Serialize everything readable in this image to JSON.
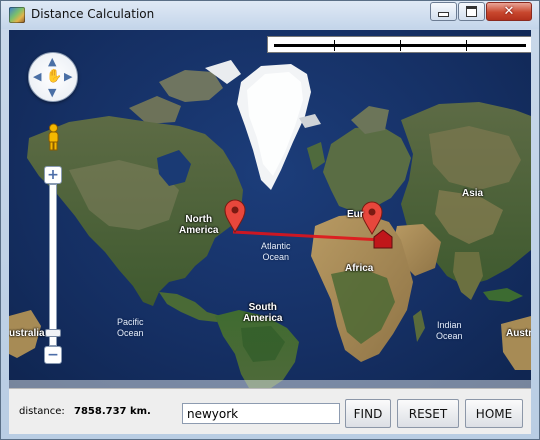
{
  "window": {
    "title": "Distance Calculation"
  },
  "map": {
    "labels": {
      "north_america": "North\nAmerica",
      "atlantic_ocean": "Atlantic\nOcean",
      "europe": "Eur",
      "asia": "Asia",
      "africa": "Africa",
      "south_america": "South\nAmerica",
      "pacific_ocean": "Pacific\nOcean",
      "indian_ocean": "Indian\nOcean",
      "australia_left": "ustralia",
      "australia_right": "Austr"
    },
    "route_color": "#e0141b",
    "marker_color": "#e8473c",
    "home_marker_color": "#c0161a"
  },
  "bottom": {
    "distance_label": "distance:",
    "distance_value": "7858.737 km.",
    "search_value": "newyork",
    "find_label": "FIND",
    "reset_label": "RESET",
    "home_label": "HOME"
  }
}
